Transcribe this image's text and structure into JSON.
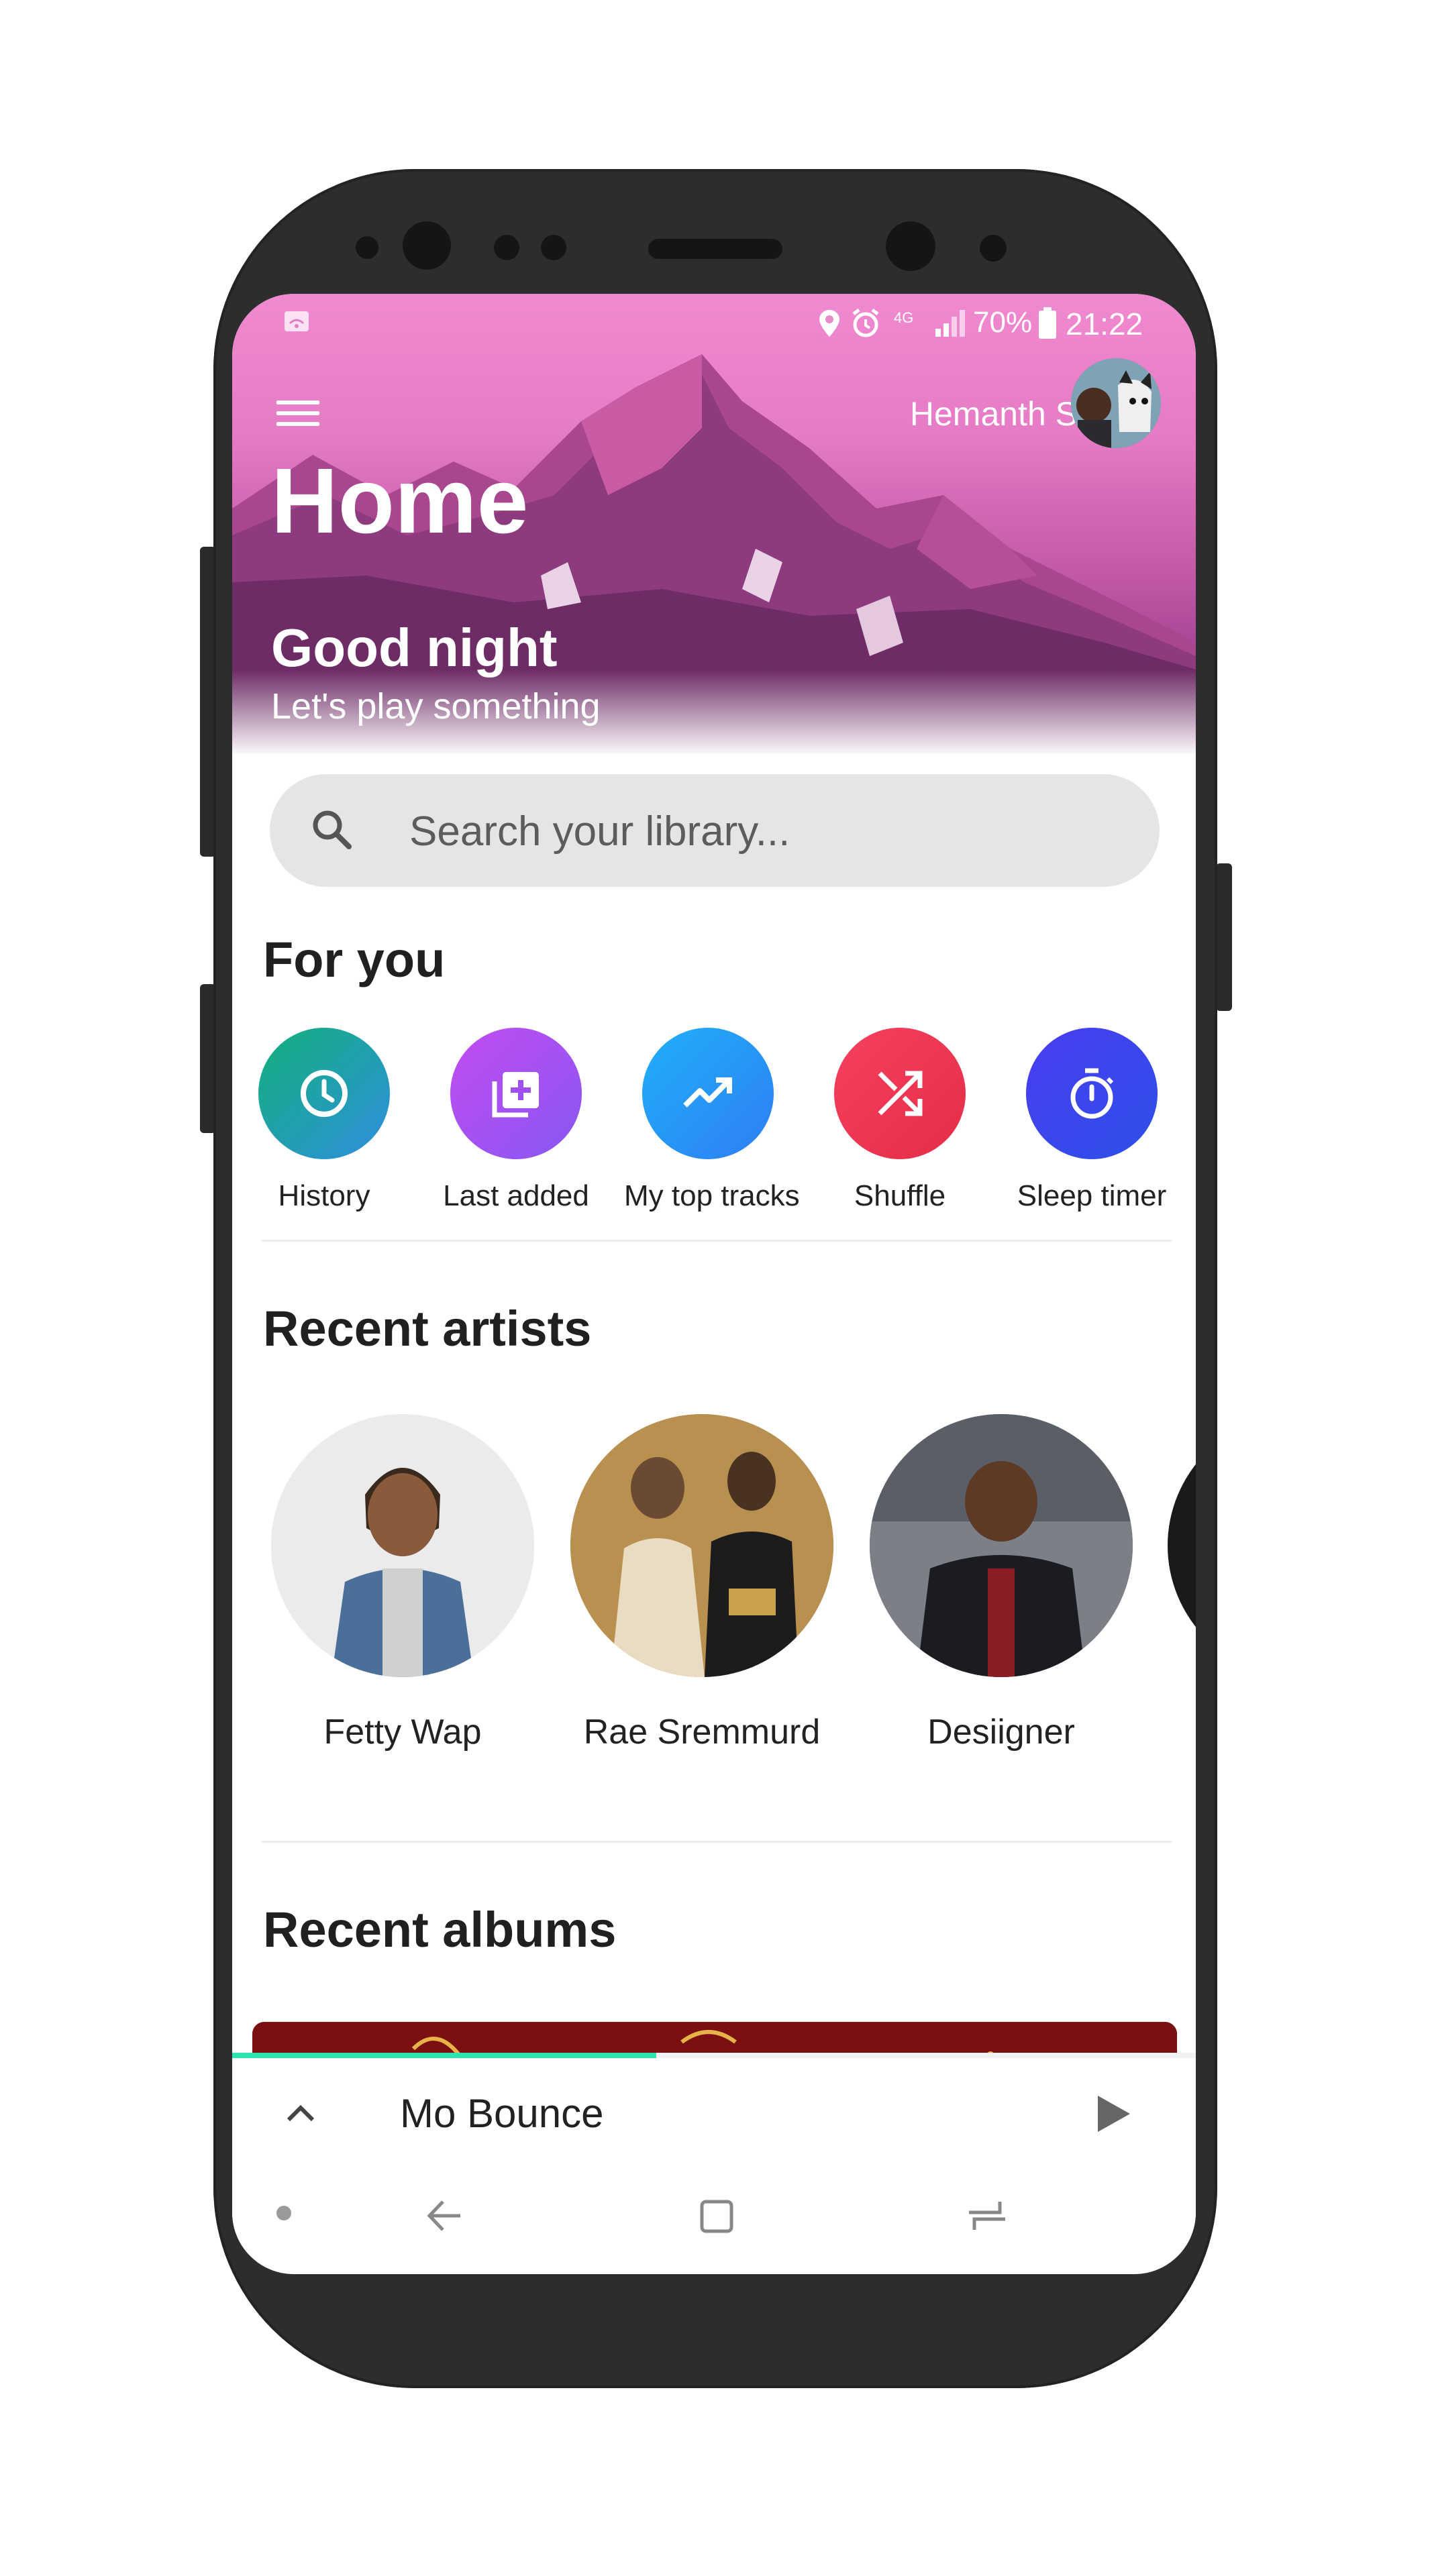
{
  "status_bar": {
    "network": "4G",
    "battery": "70%",
    "time": "21:22"
  },
  "header": {
    "user_name": "Hemanth S",
    "page_title": "Home",
    "greeting": "Good night",
    "subgreeting": "Let's play something"
  },
  "search": {
    "placeholder": "Search your library..."
  },
  "for_you": {
    "title": "For you",
    "items": [
      {
        "label": "History",
        "icon": "clock-icon",
        "color_start": "#17b37a",
        "color_end": "#2f8fe0"
      },
      {
        "label": "Last added",
        "icon": "playlist-add-icon",
        "color_start": "#c04df0",
        "color_end": "#8a55f2"
      },
      {
        "label": "My top tracks",
        "icon": "trending-up-icon",
        "color_start": "#1fa6f7",
        "color_end": "#2f7ef5"
      },
      {
        "label": "Shuffle",
        "icon": "shuffle-icon",
        "color_start": "#f23a5c",
        "color_end": "#e8304a"
      },
      {
        "label": "Sleep timer",
        "icon": "timer-icon",
        "color_start": "#4a3ff0",
        "color_end": "#2d4ee8"
      }
    ]
  },
  "recent_artists": {
    "title": "Recent artists",
    "items": [
      {
        "name": "Fetty Wap"
      },
      {
        "name": "Rae Sremmurd"
      },
      {
        "name": "Desiigner"
      }
    ]
  },
  "recent_albums": {
    "title": "Recent albums"
  },
  "player": {
    "track": "Mo Bounce",
    "progress": 0.44,
    "accent": "#2de3b2"
  }
}
